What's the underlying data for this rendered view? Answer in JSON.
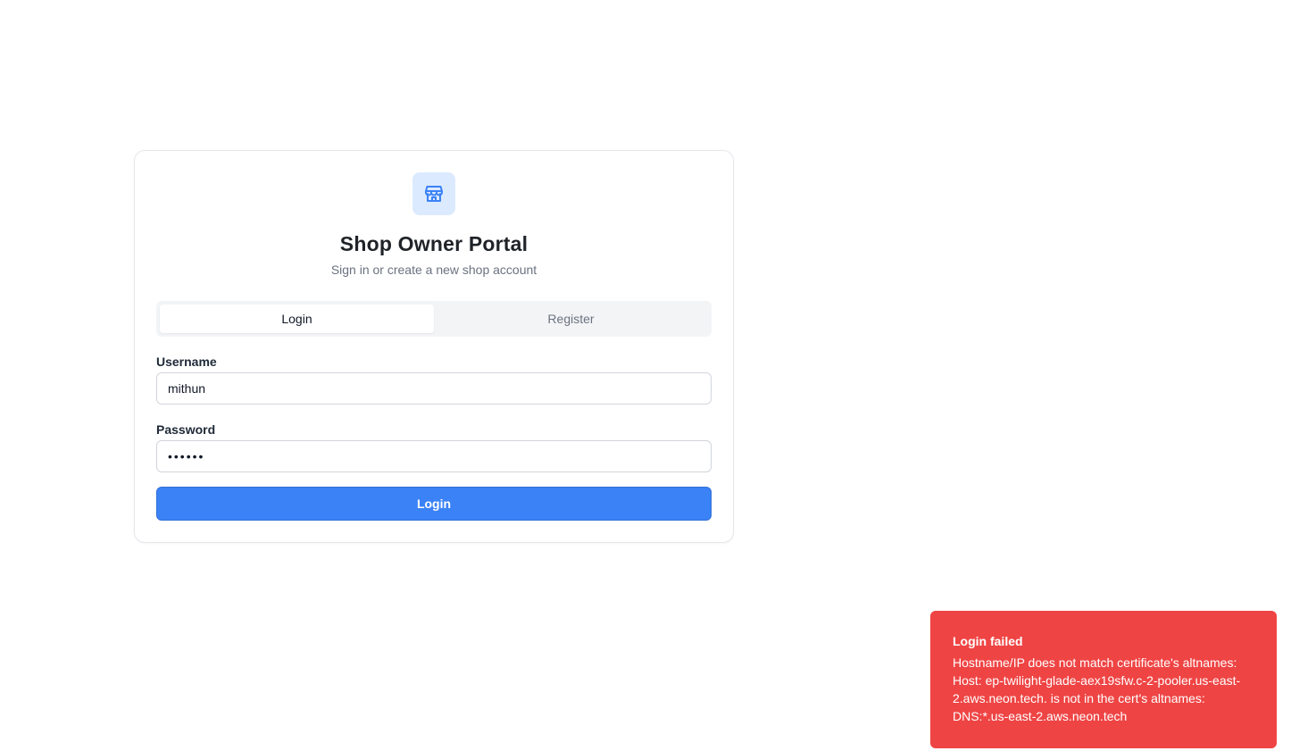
{
  "portal": {
    "title": "Shop Owner Portal",
    "subtitle": "Sign in or create a new shop account",
    "icon": "store-icon"
  },
  "tabs": [
    {
      "label": "Login",
      "active": true
    },
    {
      "label": "Register",
      "active": false
    }
  ],
  "form": {
    "username_label": "Username",
    "username_value": "mithun",
    "password_label": "Password",
    "password_value": "••••••",
    "submit_label": "Login"
  },
  "toast": {
    "title": "Login failed",
    "description": "Hostname/IP does not match certificate's altnames: Host: ep-twilight-glade-aex19sfw.c-2-pooler.us-east-2.aws.neon.tech. is not in the cert's altnames: DNS:*.us-east-2.aws.neon.tech"
  },
  "colors": {
    "primary": "#3b82f6",
    "icon_bg": "#dbeafe",
    "error": "#ef4444"
  }
}
